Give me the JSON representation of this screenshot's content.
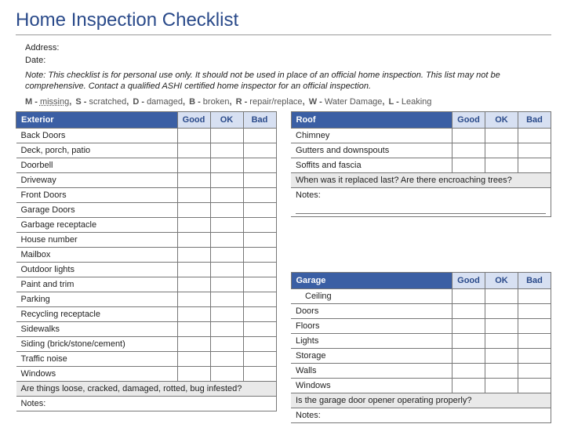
{
  "title": "Home Inspection Checklist",
  "meta": {
    "address_label": "Address:",
    "date_label": "Date:"
  },
  "note": "Note: This checklist is for personal use only. It should not be used in place of an official home inspection. This list may not be comprehensive. Contact a qualified ASHI certified home inspector for an official inspection.",
  "legend": {
    "M": "missing",
    "S": "scratched",
    "D": "damaged",
    "B": "broken",
    "R": "repair/replace",
    "W": "Water Damage",
    "L": "Leaking"
  },
  "rating_headers": {
    "good": "Good",
    "ok": "OK",
    "bad": "Bad"
  },
  "sections": {
    "exterior": {
      "title": "Exterior",
      "items": [
        "Back Doors",
        "Deck, porch, patio",
        "Doorbell",
        "Driveway",
        "Front Doors",
        "Garage Doors",
        "Garbage receptacle",
        "House number",
        "Mailbox",
        "Outdoor lights",
        "Paint and trim",
        "Parking",
        "Recycling receptacle",
        "Sidewalks",
        "Siding (brick/stone/cement)",
        "Traffic noise",
        "Windows"
      ],
      "prompt": "Are things loose, cracked, damaged, rotted, bug infested?",
      "notes_label": "Notes:"
    },
    "roof": {
      "title": "Roof",
      "items": [
        "Chimney",
        "Gutters and downspouts",
        "Soffits and fascia"
      ],
      "prompt": "When was it replaced last? Are there encroaching trees?",
      "notes_label": "Notes:"
    },
    "garage": {
      "title": "Garage",
      "items": [
        "Ceiling",
        "Doors",
        "Floors",
        "Lights",
        "Storage",
        "Walls",
        "Windows"
      ],
      "prompt": "Is the garage door opener operating properly?",
      "notes_label": "Notes:"
    }
  }
}
